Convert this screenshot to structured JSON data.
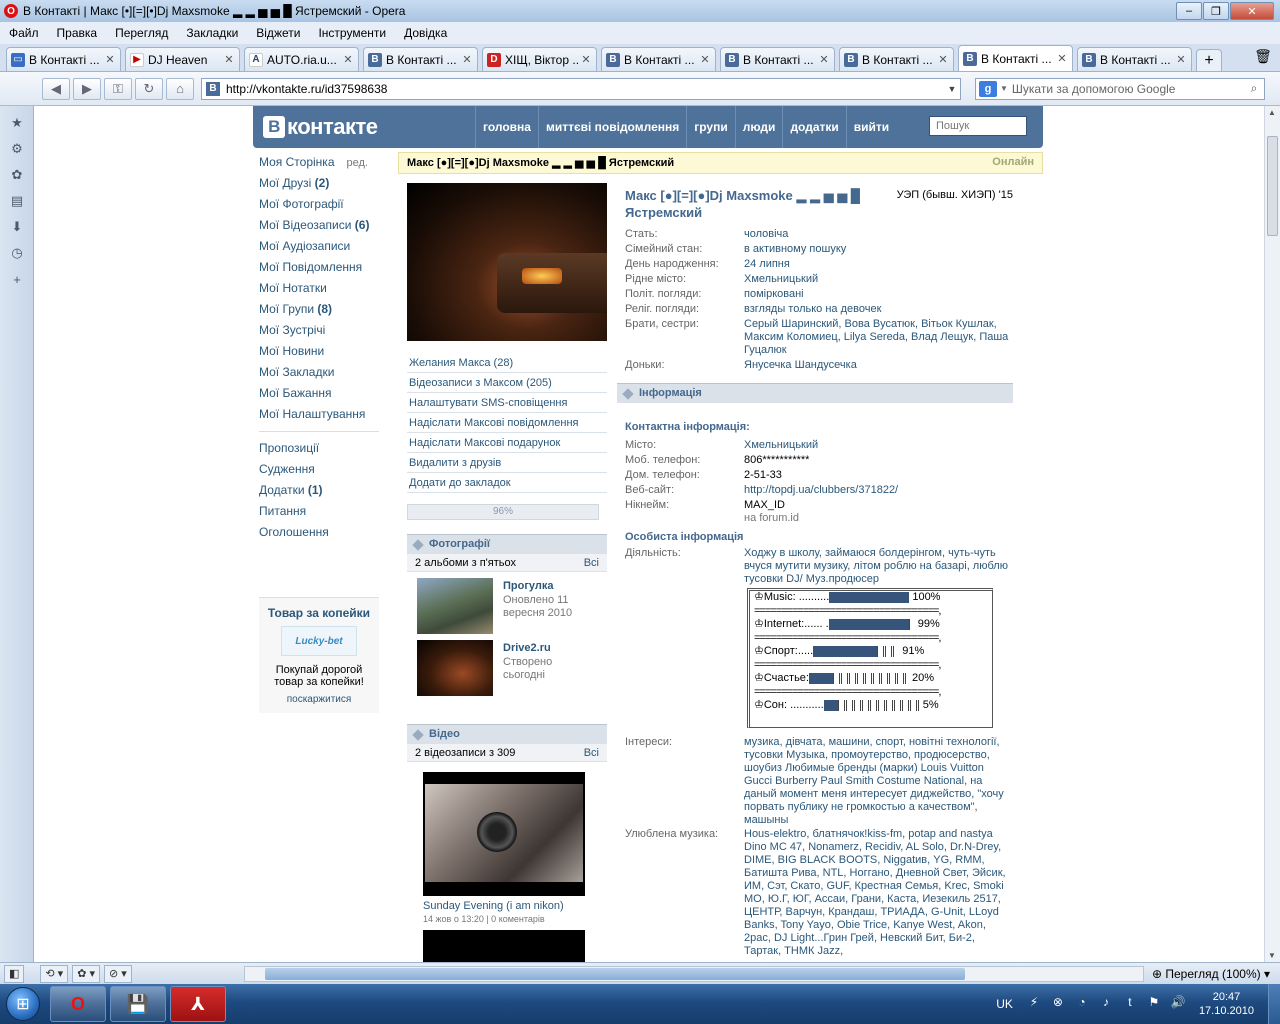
{
  "window": {
    "title": "В Контакті | Макс [•][=][•]Dj Maxsmoke ▂ ▂ ▅ ▅ █ Ястремский - Opera",
    "minimize": "–",
    "restore": "❐",
    "close": "✕"
  },
  "menu": [
    "Файл",
    "Правка",
    "Перегляд",
    "Закладки",
    "Віджети",
    "Інструменти",
    "Довідка"
  ],
  "tabs": [
    {
      "label": "В Контакті ...",
      "icon": "msg"
    },
    {
      "label": "DJ Heaven",
      "icon": "dj"
    },
    {
      "label": "AUTO.ria.u...",
      "icon": "auto"
    },
    {
      "label": "В Контакті ...",
      "icon": "vk"
    },
    {
      "label": "ХІЩ, Віктор ...",
      "icon": "d"
    },
    {
      "label": "В Контакті ...",
      "icon": "vk"
    },
    {
      "label": "В Контакті ...",
      "icon": "vk"
    },
    {
      "label": "В Контакті ...",
      "icon": "vk"
    },
    {
      "label": "В Контакті ...",
      "icon": "vk",
      "active": true
    },
    {
      "label": "В Контакті ...",
      "icon": "vk"
    }
  ],
  "address": {
    "url": "http://vkontakte.ru/id37598638"
  },
  "search": {
    "placeholder": "Шукати за допомогою Google"
  },
  "vk": {
    "logo": "контакте",
    "nav": [
      "головна",
      "миттєві повідомлення",
      "групи",
      "люди",
      "додатки",
      "вийти"
    ],
    "search_placeholder": "Пошук"
  },
  "leftmenu": {
    "items": [
      {
        "label": "Моя Сторінка",
        "extra": "ред."
      },
      {
        "label": "Мої Друзі",
        "count": "(2)"
      },
      {
        "label": "Мої Фотографії"
      },
      {
        "label": "Мої Відеозаписи",
        "count": "(6)"
      },
      {
        "label": "Мої Аудіозаписи"
      },
      {
        "label": "Мої Повідомлення"
      },
      {
        "label": "Мої Нотатки"
      },
      {
        "label": "Мої Групи",
        "count": "(8)"
      },
      {
        "label": "Мої Зустрічі"
      },
      {
        "label": "Мої Новини"
      },
      {
        "label": "Мої Закладки"
      },
      {
        "label": "Мої Бажання"
      },
      {
        "label": "Мої Налаштування"
      }
    ],
    "items2": [
      {
        "label": "Пропозиції"
      },
      {
        "label": "Судження"
      },
      {
        "label": "Додатки",
        "count": "(1)"
      },
      {
        "label": "Питання"
      },
      {
        "label": "Оголошення"
      }
    ]
  },
  "promo": {
    "title": "Товар за копейки",
    "logo": "Lucky-bet",
    "desc": "Покупай дорогой товар за копейки!",
    "link": "поскаржитися"
  },
  "profile": {
    "bar_name": "Макс [●][=][●]Dj Maxsmoke ▂ ▂ ▅ ▅ █ Ястремский",
    "online": "Онлайн",
    "name": "Макс [●][=][●]Dj Maxsmoke ▂ ▂ ▅ ▅ █ Ястремский",
    "university": "УЭП (бывш. ХИЭП) '15",
    "actions": [
      "Желания Макса (28)",
      "Відеозаписи з Максом (205)",
      "Налаштувати SMS-сповіщення",
      "Надіслати Максові повідомлення",
      "Надіслати Максові подарунок",
      "Видалити з друзів",
      "Додати до закладок"
    ],
    "rating": "96%",
    "basic": [
      {
        "label": "Стать:",
        "value": "чоловіча"
      },
      {
        "label": "Сімейний стан:",
        "value": "в активному пошуку"
      },
      {
        "label": "День народження:",
        "value": "24 липня"
      },
      {
        "label": "Рідне місто:",
        "value": "Хмельницький"
      },
      {
        "label": "Політ. погляди:",
        "value": "помірковані"
      },
      {
        "label": "Реліг. погляди:",
        "value": "взгляды только на девочек"
      },
      {
        "label": "Брати, сестри:",
        "value": "Серый Шаринский, Вова Вусатюк, Вітьок Кушлак, Максим Коломиец, Lilya Sereda, Влад Лещук, Паша Гуцалюк"
      },
      {
        "label": "Доньки:",
        "value": "Янусечка Шандусечка"
      }
    ],
    "info_header": "Інформація",
    "contact_header": "Контактна інформація:",
    "contacts": [
      {
        "label": "Місто:",
        "value": "Хмельницький"
      },
      {
        "label": "Моб. телефон:",
        "value": "806***********"
      },
      {
        "label": "Дом. телефон:",
        "value": "2-51-33"
      },
      {
        "label": "Веб-сайт:",
        "value": "http://topdj.ua/clubbers/371822/"
      },
      {
        "label": "Нікнейм:",
        "value": "MAX_ID",
        "sub": "на forum.id"
      }
    ],
    "personal_header": "Особиста інформація",
    "activity": {
      "label": "Діяльність:",
      "value": "Ходжу в школу, займаюся болдерінгом, чуть-чуть вчуся мутити музику, літом роблю на базарі, люблю тусовки DJ/ Муз.продюсер"
    },
    "meters": [
      {
        "prefix": "♔Music: ..........",
        "level": 100,
        "label": "100%"
      },
      {
        "prefix": "♔Internet:...... .",
        "level": 99,
        "label": "99%"
      },
      {
        "prefix": "♔Спорт:.....",
        "level": 91,
        "label": "91%"
      },
      {
        "prefix": "♔Счастье:",
        "level": 20,
        "label": "20%"
      },
      {
        "prefix": "♔Сон: ...........",
        "level": 5,
        "label": "5%"
      }
    ],
    "meter_sep": "==================================,",
    "interests": {
      "label": "Інтереси:",
      "value": "музика, дівчата, машини, спорт, новітні технології, тусовки Музыка, промоутерство, продюсерство, шоубиз Любимые бренды (марки) Louis Vuitton Gucci Burberry Paul Smith Costume National, на даный момент меня интересует диджейство, \"хочу порвать публику не громкостью а качеством\", машыны"
    },
    "music": {
      "label": "Улюблена музика:",
      "value": "Hous-elektro, блатнячок!kiss-fm, potap and nastya Dino MC 47, Nonamerz, Recidiv, AL Solo, Dr.N-Drey, DIME, BIG BLACK BOOTS, Niggatив, YG, RMM, Батишта Рива, NTL, Ноггано, Дневной Свет, Эйсик, ИМ, Сэт, Скато, GUF, Крестная Семья, Krec, Smoki MO, Ю.Г, ЮГ, Ассаи, Грани, Каста, Иезекиль 2517, ЦЕНТР, Варчун, Крандаш, ТРИАДА, G-Unit, LLoyd Banks, Tony Yayo, Obie Trice, Kanye West, Akon, 2pac, DJ Light...Грин Грей, Невский Бит, Би-2, Тартак, ТНМК Jazz,"
    },
    "photos": {
      "header": "Фотографії",
      "sub": "2 альбоми з п'ятьох",
      "all": "Всі",
      "albums": [
        {
          "name": "Прогулка",
          "desc": "Оновлено 11 вересня 2010"
        },
        {
          "name": "Drive2.ru",
          "desc": "Створено сьогодні"
        }
      ]
    },
    "videos": {
      "header": "Відео",
      "sub": "2 відеозаписи з 309",
      "all": "Всі",
      "items": [
        {
          "title": "Sunday Evening (i am nikon)",
          "meta": "14 жов о 13:20 | 0 коментарів"
        }
      ]
    }
  },
  "statusbar": {
    "zoom": "Перегляд (100%)"
  },
  "taskbar": {
    "lang": "UK",
    "time": "20:47",
    "date": "17.10.2010"
  }
}
